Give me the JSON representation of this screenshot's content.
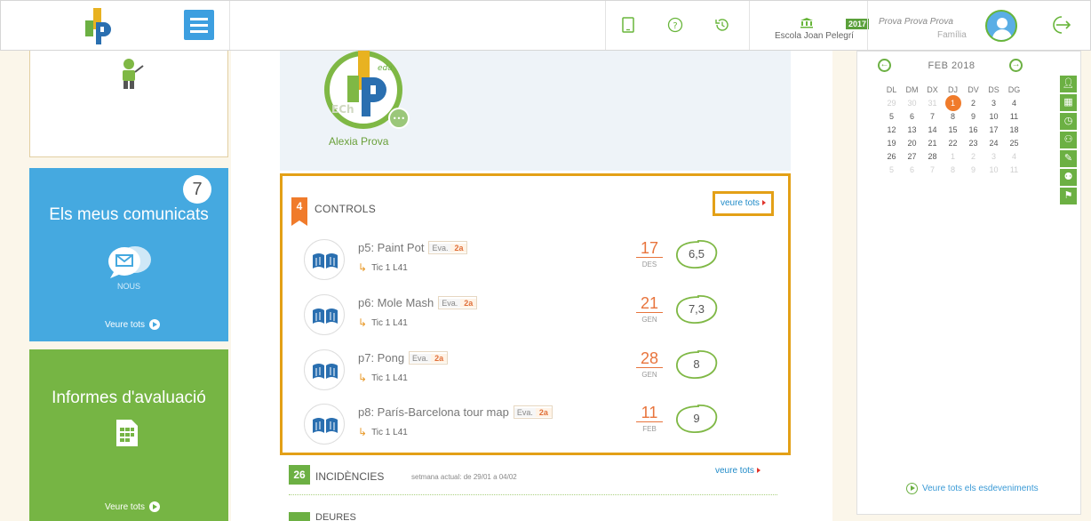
{
  "topbar": {
    "school_name": "Escola Joan Pelegrí",
    "year_badge": "2017",
    "user_name": "Prova Prova Prova",
    "user_role": "Família",
    "icons": [
      "tablet-icon",
      "help-icon",
      "history-icon",
      "school-icon",
      "logout-icon"
    ]
  },
  "left": {
    "messages": {
      "count": "7",
      "title": "Els meus comunicats",
      "sub": "NOUS",
      "see_all": "Veure tots"
    },
    "reports": {
      "title": "Informes d'avaluació",
      "see_all": "Veure tots"
    }
  },
  "profile": {
    "name": "Alexia Prova",
    "logo_text": "JP"
  },
  "controls": {
    "count": "4",
    "title": "CONTROLS",
    "see_all": "veure tots",
    "items": [
      {
        "title": "p5: Paint Pot",
        "tag_a": "Eva.",
        "tag_b": "2a",
        "sub": "Tic 1 L41",
        "day": "17",
        "month": "DES",
        "grade": "6,5"
      },
      {
        "title": "p6: Mole Mash",
        "tag_a": "Eva.",
        "tag_b": "2a",
        "sub": "Tic 1 L41",
        "day": "21",
        "month": "GEN",
        "grade": "7,3"
      },
      {
        "title": "p7: Pong",
        "tag_a": "Eva.",
        "tag_b": "2a",
        "sub": "Tic 1 L41",
        "day": "28",
        "month": "GEN",
        "grade": "8"
      },
      {
        "title": "p8: París-Barcelona tour map",
        "tag_a": "Eva.",
        "tag_b": "2a",
        "sub": "Tic 1 L41",
        "day": "11",
        "month": "FEB",
        "grade": "9"
      }
    ]
  },
  "incidences": {
    "count": "26",
    "title": "INCIDÈNCIES",
    "note": "setmana actual: de 29/01 a 04/02",
    "see_all": "veure tots"
  },
  "next_section": {
    "title": "DEURES"
  },
  "calendar": {
    "month": "FEB 2018",
    "weekdays": [
      "DL",
      "DM",
      "DX",
      "DJ",
      "DV",
      "DS",
      "DG"
    ],
    "weeks": [
      [
        {
          "d": "29",
          "dim": true
        },
        {
          "d": "30",
          "dim": true
        },
        {
          "d": "31",
          "dim": true
        },
        {
          "d": "1",
          "today": true
        },
        {
          "d": "2"
        },
        {
          "d": "3"
        },
        {
          "d": "4"
        }
      ],
      [
        {
          "d": "5"
        },
        {
          "d": "6"
        },
        {
          "d": "7"
        },
        {
          "d": "8"
        },
        {
          "d": "9"
        },
        {
          "d": "10"
        },
        {
          "d": "11"
        }
      ],
      [
        {
          "d": "12"
        },
        {
          "d": "13"
        },
        {
          "d": "14"
        },
        {
          "d": "15"
        },
        {
          "d": "16"
        },
        {
          "d": "17"
        },
        {
          "d": "18"
        }
      ],
      [
        {
          "d": "19"
        },
        {
          "d": "20"
        },
        {
          "d": "21"
        },
        {
          "d": "22"
        },
        {
          "d": "23"
        },
        {
          "d": "24"
        },
        {
          "d": "25"
        }
      ],
      [
        {
          "d": "26"
        },
        {
          "d": "27"
        },
        {
          "d": "28"
        },
        {
          "d": "1",
          "dim": true
        },
        {
          "d": "2",
          "dim": true
        },
        {
          "d": "3",
          "dim": true
        },
        {
          "d": "4",
          "dim": true
        }
      ],
      [
        {
          "d": "5",
          "dim": true
        },
        {
          "d": "6",
          "dim": true
        },
        {
          "d": "7",
          "dim": true
        },
        {
          "d": "8",
          "dim": true
        },
        {
          "d": "9",
          "dim": true
        },
        {
          "d": "10",
          "dim": true
        },
        {
          "d": "11",
          "dim": true
        }
      ]
    ],
    "see_all": "Veure tots els esdeveniments",
    "tools": [
      "user-icon",
      "calendar-icon",
      "clock-icon",
      "people-icon",
      "pencil-icon",
      "group-icon",
      "flag-icon"
    ]
  },
  "colors": {
    "accent_green": "#6cb043",
    "accent_orange": "#f07b2b",
    "highlight": "#e3a017",
    "blue": "#45a9e0"
  }
}
